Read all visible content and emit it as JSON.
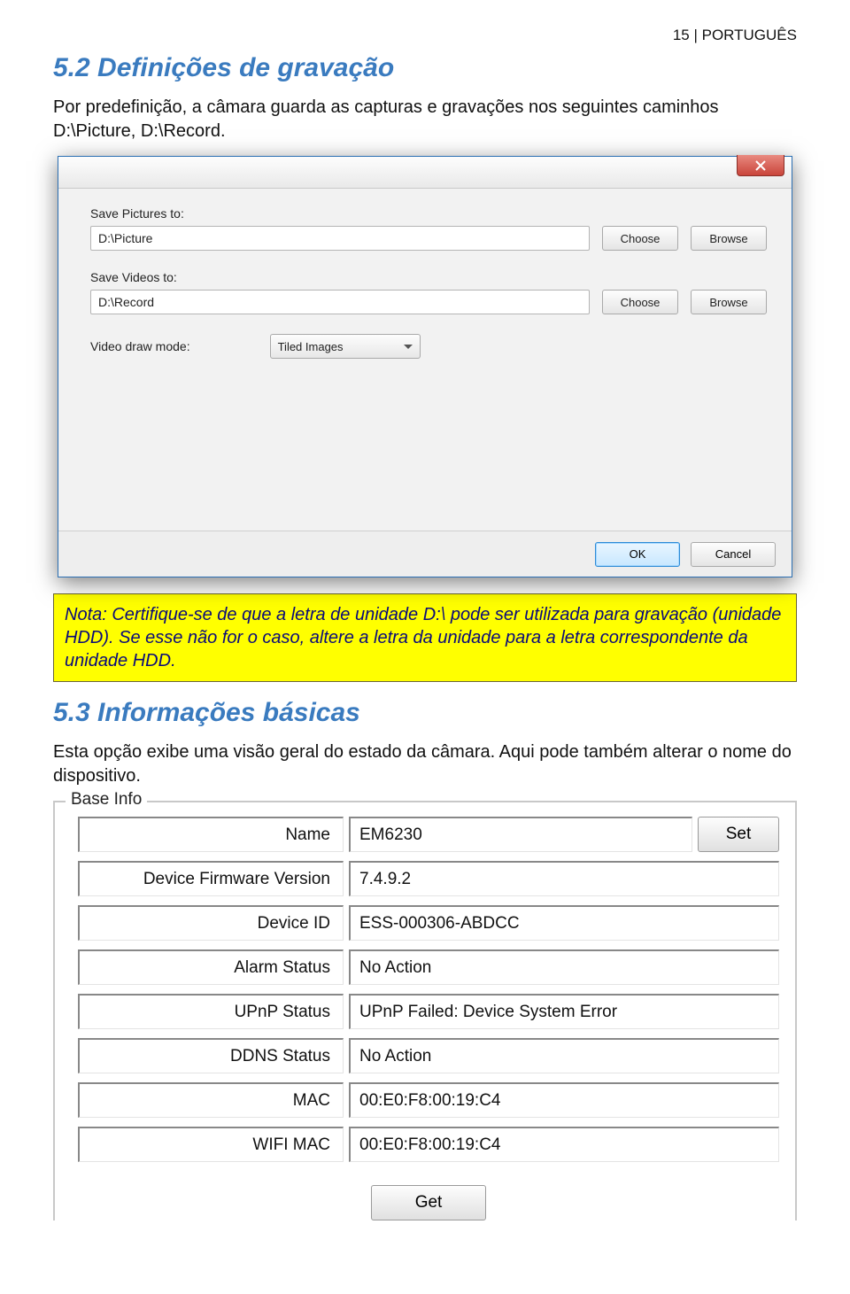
{
  "header": {
    "page_lang": "15 | PORTUGUÊS"
  },
  "section1": {
    "heading": "5.2 Definições de gravação",
    "intro": "Por predefinição, a câmara guarda as capturas e gravações nos seguintes caminhos D:\\Picture, D:\\Record."
  },
  "dialog1": {
    "save_pictures_label": "Save Pictures to:",
    "save_pictures_value": "D:\\Picture",
    "save_videos_label": "Save Videos to:",
    "save_videos_value": "D:\\Record",
    "choose_label": "Choose",
    "browse_label": "Browse",
    "video_draw_mode_label": "Video draw mode:",
    "video_draw_mode_value": "Tiled Images",
    "ok_label": "OK",
    "cancel_label": "Cancel"
  },
  "note": "Nota: Certifique-se de que a letra de unidade D:\\ pode ser utilizada para gravação (unidade HDD). Se esse não for o caso, altere a letra da unidade para a letra correspondente da unidade HDD.",
  "section2": {
    "heading": "5.3 Informações básicas",
    "intro": "Esta opção exibe uma visão geral do estado da câmara. Aqui pode também alterar o nome do dispositivo."
  },
  "base_info": {
    "legend": "Base Info",
    "set_label": "Set",
    "get_label": "Get",
    "rows": [
      {
        "label": "Name",
        "value": "EM6230"
      },
      {
        "label": "Device Firmware Version",
        "value": "7.4.9.2"
      },
      {
        "label": "Device ID",
        "value": "ESS-000306-ABDCC"
      },
      {
        "label": "Alarm Status",
        "value": "No Action"
      },
      {
        "label": "UPnP Status",
        "value": "UPnP Failed: Device System Error"
      },
      {
        "label": "DDNS Status",
        "value": "No Action"
      },
      {
        "label": "MAC",
        "value": "00:E0:F8:00:19:C4"
      },
      {
        "label": "WIFI MAC",
        "value": "00:E0:F8:00:19:C4"
      }
    ]
  }
}
